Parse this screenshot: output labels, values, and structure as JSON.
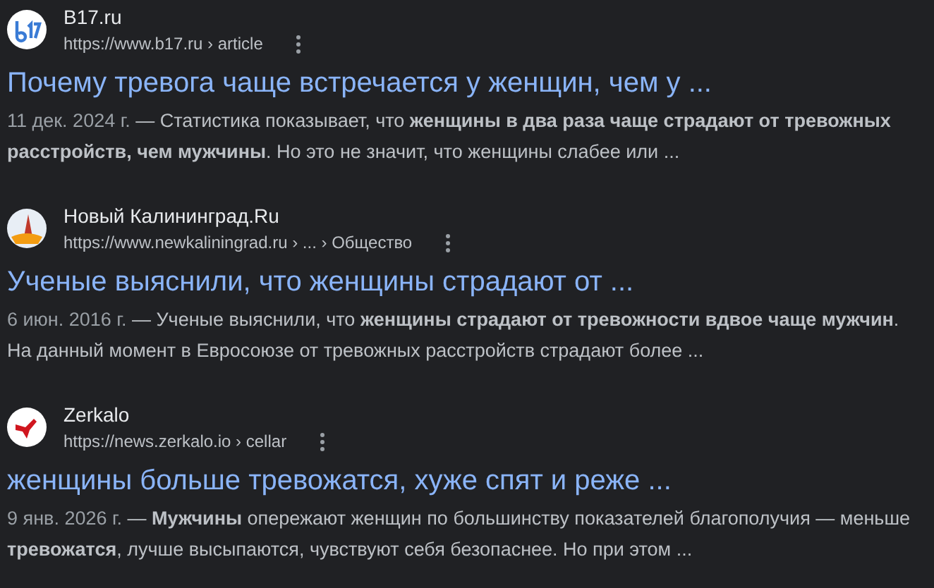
{
  "results": [
    {
      "kind": "b17",
      "site": "B17.ru",
      "url": "https://www.b17.ru › article",
      "title": "Почему тревога чаще встречается у женщин, чем у ...",
      "date": "11 дек. 2024 г.",
      "snippet": "— Статистика показывает, что **женщины в два раза чаще страдают от тревожных расстройств, чем мужчины**. Но это не значит, что женщины слабее или ..."
    },
    {
      "kind": "tower",
      "site": "Новый Калининград.Ru",
      "url": "https://www.newkaliningrad.ru › ... › Общество",
      "title": "Ученые выяснили, что женщины страдают от ...",
      "date": "6 июн. 2016 г.",
      "snippet": "— Ученые выяснили, что **женщины страдают от тревожности вдвое чаще мужчин**. На данный момент в Евросоюзе от тревожных расстройств страдают более ..."
    },
    {
      "kind": "bird",
      "site": "Zerkalo",
      "url": "https://news.zerkalo.io › cellar",
      "title": "женщины больше тревожатся, хуже спят и реже ...",
      "date": "9 янв. 2026 г.",
      "snippet": "— **Мужчины** опережают женщин по большинству показателей благополучия — меньше **тревожатся**, лучше высыпаются, чувствуют себя безопаснее. Но при этом ..."
    }
  ]
}
